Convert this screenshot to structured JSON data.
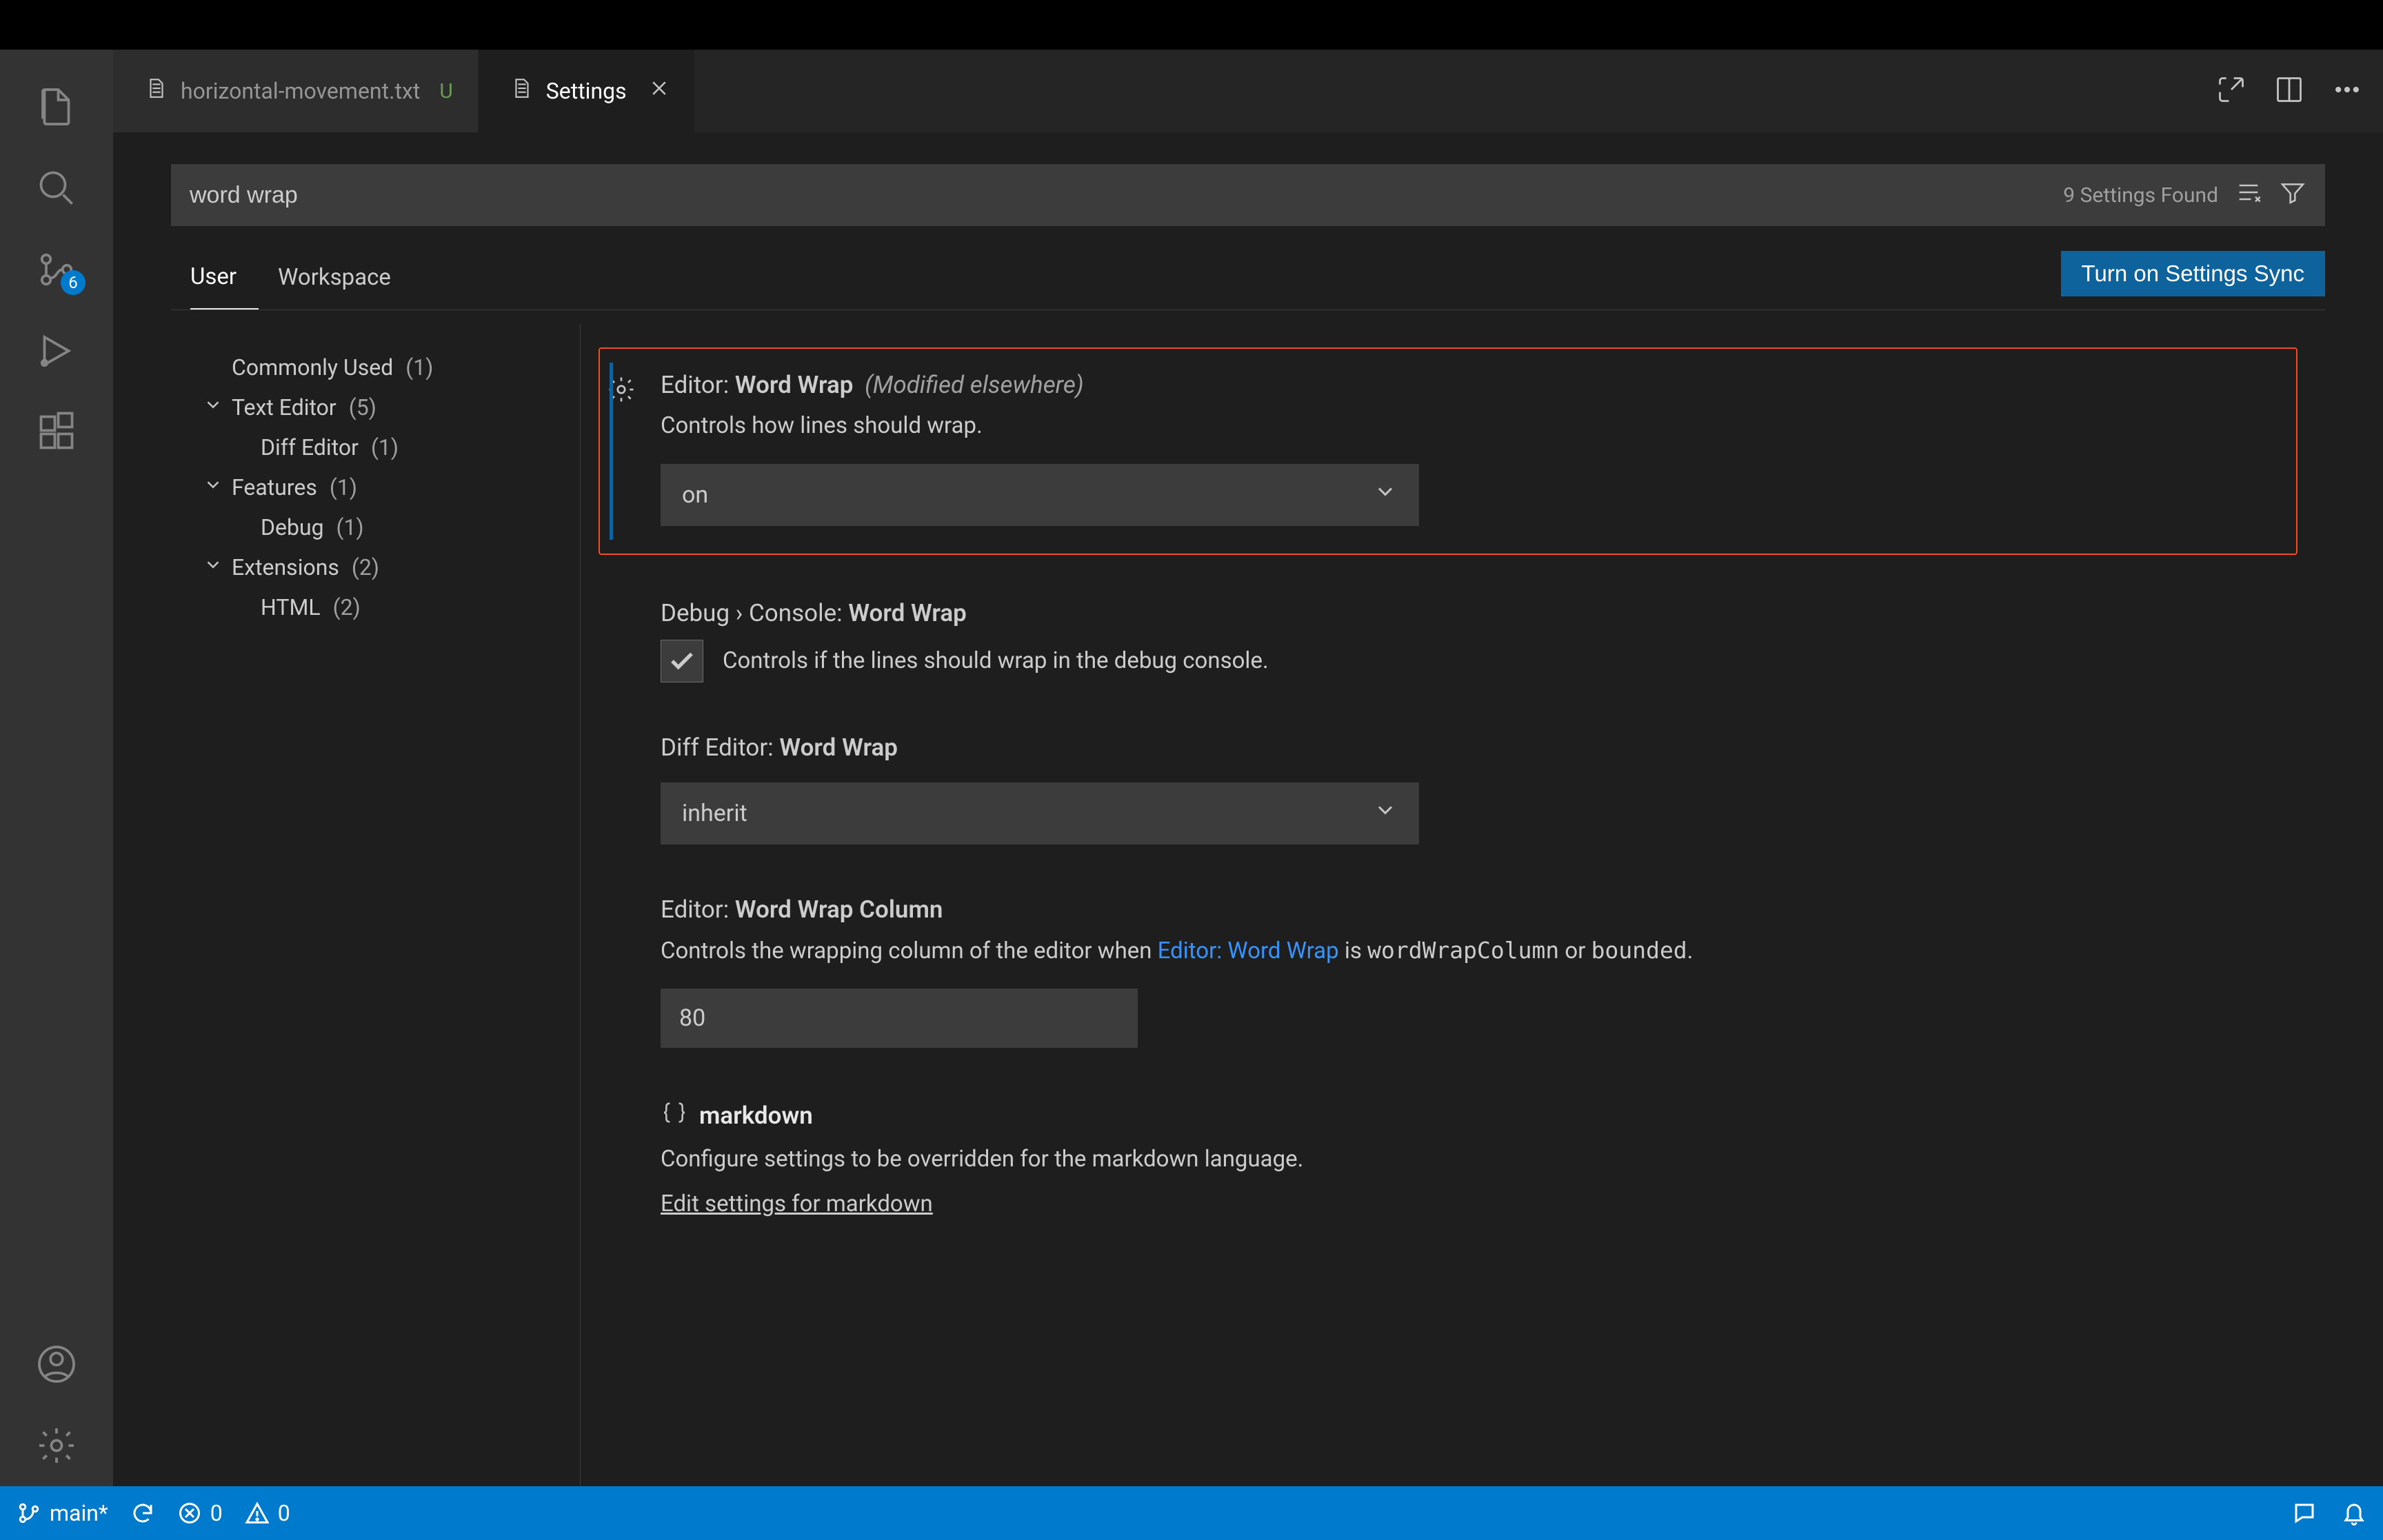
{
  "tabs": {
    "file": {
      "name": "horizontal-movement.txt",
      "status": "U"
    },
    "settings": {
      "label": "Settings"
    }
  },
  "search": {
    "value": "word wrap",
    "found": "9 Settings Found"
  },
  "scope": {
    "user": "User",
    "workspace": "Workspace"
  },
  "syncButton": "Turn on Settings Sync",
  "toc": {
    "commonly": {
      "label": "Commonly Used",
      "count": "(1)"
    },
    "textEditor": {
      "label": "Text Editor",
      "count": "(5)"
    },
    "diffEditor": {
      "label": "Diff Editor",
      "count": "(1)"
    },
    "features": {
      "label": "Features",
      "count": "(1)"
    },
    "debug": {
      "label": "Debug",
      "count": "(1)"
    },
    "extensions": {
      "label": "Extensions",
      "count": "(2)"
    },
    "html": {
      "label": "HTML",
      "count": "(2)"
    }
  },
  "settings": {
    "wordWrap": {
      "prefix": "Editor: ",
      "name": "Word Wrap",
      "badge": "(Modified elsewhere)",
      "desc": "Controls how lines should wrap.",
      "value": "on"
    },
    "debugConsole": {
      "prefix": "Debug › Console: ",
      "name": "Word Wrap",
      "desc": "Controls if the lines should wrap in the debug console.",
      "checked": true
    },
    "diffWrap": {
      "prefix": "Diff Editor: ",
      "name": "Word Wrap",
      "value": "inherit"
    },
    "wrapColumn": {
      "prefix": "Editor: ",
      "name": "Word Wrap Column",
      "desc_a": "Controls the wrapping column of the editor when ",
      "desc_link": "Editor: Word Wrap",
      "desc_b": " is ",
      "desc_code1": "wordWrapColumn",
      "desc_c": " or ",
      "desc_code2": "bounded",
      "desc_d": ".",
      "value": "80"
    },
    "markdown": {
      "name": "markdown",
      "desc": "Configure settings to be overridden for the markdown language.",
      "link": "Edit settings for markdown"
    }
  },
  "activity": {
    "scmBadge": "6"
  },
  "status": {
    "branch": "main*",
    "errors": "0",
    "warnings": "0"
  }
}
